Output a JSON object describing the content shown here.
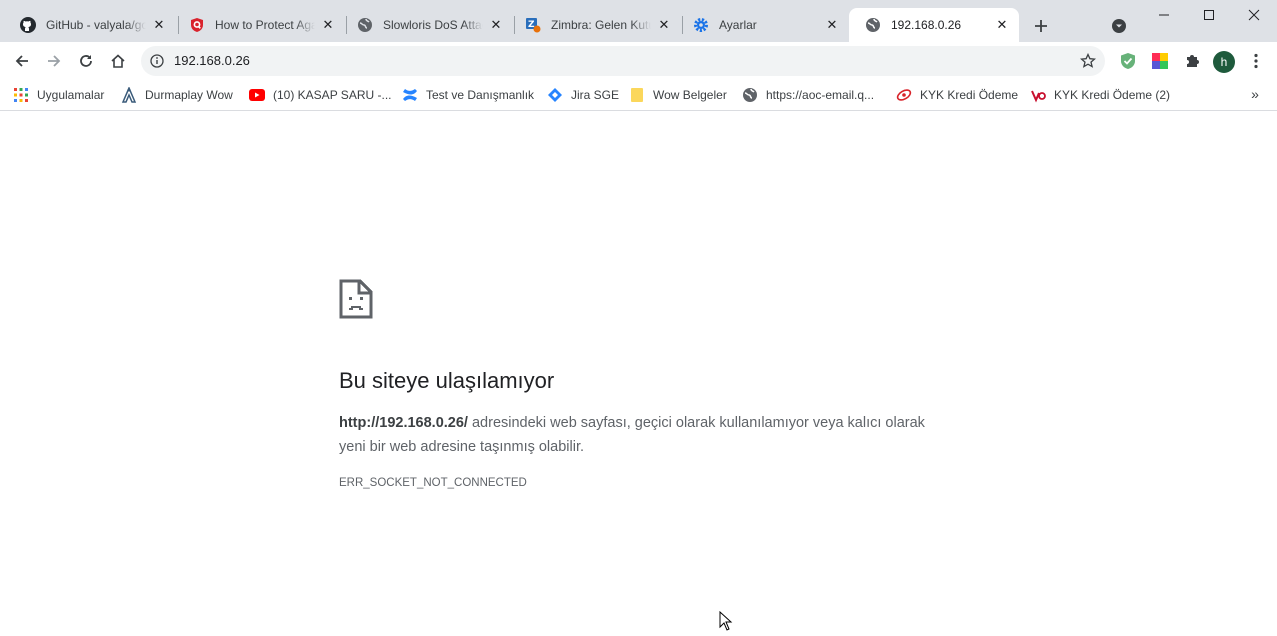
{
  "tabs": [
    {
      "title": "GitHub - valyala/goreplay",
      "icon": "github-icon"
    },
    {
      "title": "How to Protect Against Slowloris",
      "icon": "shield-q-icon"
    },
    {
      "title": "Slowloris DoS Attack",
      "icon": "globe-icon"
    },
    {
      "title": "Zimbra: Gelen Kutusu",
      "icon": "zimbra-icon"
    },
    {
      "title": "Ayarlar",
      "icon": "gear-icon"
    },
    {
      "title": "192.168.0.26",
      "icon": "globe-icon",
      "active": true
    }
  ],
  "omnibox": {
    "url": "192.168.0.26"
  },
  "bookmarks": [
    {
      "label": "Uygulamalar",
      "icon": "apps-grid-icon"
    },
    {
      "label": "Durmaplay Wow",
      "icon": "durmaplay-icon"
    },
    {
      "label": "(10) KASAP SARU -...",
      "icon": "youtube-icon"
    },
    {
      "label": "Test ve Danışmanlık",
      "icon": "confluence-icon"
    },
    {
      "label": "Jira SGE",
      "icon": "jira-icon"
    },
    {
      "label": "Wow Belgeler",
      "icon": "folder-icon"
    },
    {
      "label": "https://aoc-email.q...",
      "icon": "globe-icon"
    },
    {
      "label": "KYK Kredi Ödeme",
      "icon": "kyk-icon"
    },
    {
      "label": "KYK Kredi Ödeme (2)",
      "icon": "vakifbank-icon"
    }
  ],
  "profile": {
    "initial": "h"
  },
  "error": {
    "title": "Bu siteye ulaşılamıyor",
    "url_bold": "http://192.168.0.26/",
    "description": " adresindeki web sayfası, geçici olarak kullanılamıyor veya kalıcı olarak yeni bir web adresine taşınmış olabilir.",
    "code": "ERR_SOCKET_NOT_CONNECTED"
  }
}
